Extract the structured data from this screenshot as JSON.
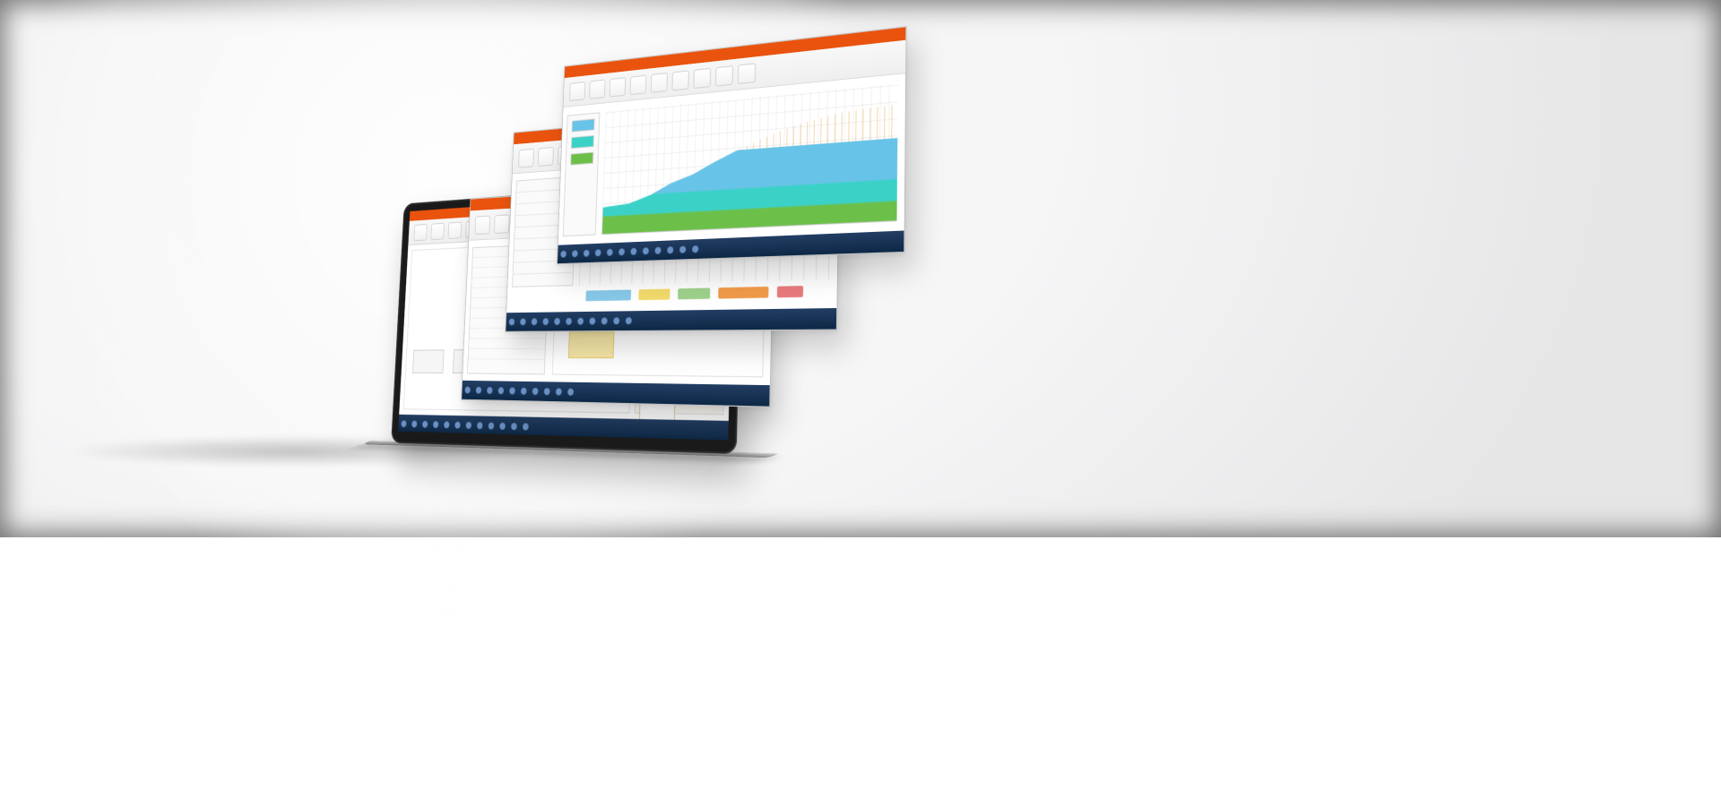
{
  "description": "Marketing hero image: a laptop rendered in 3D perspective with three floating application window screenshots fanned behind it. The app windows have an orange title bar and ribbon toolbar; the front-most window shows a stacked area chart in blue/teal/green; the next shows a grid/Gantt view; the third shows a tree + diagram. The laptop screen shows the same app with a small palette on the right. Background is light grey with a soft arc and an inner dark vignette.",
  "accent_color": "#e9530e",
  "chart_colors": [
    "#68c3e8",
    "#3bd1c7",
    "#6cc04a"
  ],
  "taskbar_color": "#173351"
}
